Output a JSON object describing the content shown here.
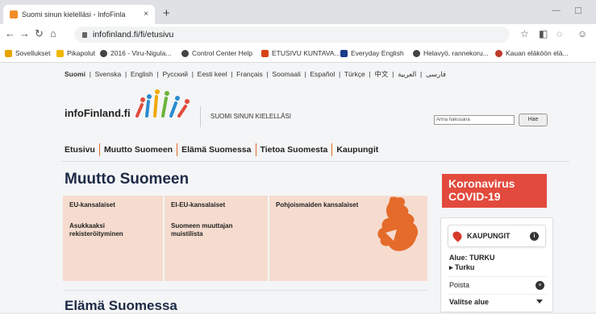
{
  "browser": {
    "tab_title": "Suomi sinun kielelläsi - InfoFinla",
    "tab_close": "×",
    "new_tab": "+",
    "url": "infofinland.fi/fi/etusivu"
  },
  "bookmarks": [
    {
      "label": "Sovellukset",
      "color": "#e6a400"
    },
    {
      "label": "Pikapolut",
      "color": "#f2b600"
    },
    {
      "label": "2016 - Viru-Nigula...",
      "color": "#444444"
    },
    {
      "label": "Control Center Help",
      "color": "#444444"
    },
    {
      "label": "ETUSIVU KUNTAVA...",
      "color": "#d84315"
    },
    {
      "label": "Everyday English",
      "color": "#1a3c8c"
    },
    {
      "label": "Helavyö, rannekoru...",
      "color": "#444444"
    },
    {
      "label": "Kauan eläköön elä...",
      "color": "#c0392b"
    }
  ],
  "languages": [
    "Suomi",
    "Svenska",
    "English",
    "Русский",
    "Eesti keel",
    "Français",
    "Soomaali",
    "Español",
    "Türkçe",
    "中文",
    "فارسی",
    "العربية"
  ],
  "header": {
    "logo": "infoFinland.fi",
    "tagline": "SUOMI SINUN KIELELLÄSI",
    "search_placeholder": "Anna hakusana",
    "search_button": "Hae"
  },
  "nav": [
    "Etusivu",
    "Muutto Suomeen",
    "Elämä Suomessa",
    "Tietoa Suomesta",
    "Kaupungit"
  ],
  "main": {
    "title": "Muutto Suomeen",
    "cells": [
      "EU-kansalaiset",
      "EI-EU-kansalaiset",
      "Pohjoismaiden kansalaiset",
      "Asukkaaksi rekisteröityminen",
      "Suomeen muuttajan muistilista"
    ],
    "next_title": "Elämä Suomessa"
  },
  "sidebar": {
    "corona": "Koronavirus COVID-19",
    "kaupungit": "KAUPUNGIT",
    "info": "i",
    "alue_label": "Alue: TURKU",
    "alue_item": "▸ Turku",
    "poista": "Poista",
    "poista_icon": "×",
    "valitse": "Valitse alue"
  },
  "colors": {
    "accent": "#e46b2a",
    "corona": "#e24a3d",
    "cell_bg": "#f6dccf",
    "title": "#1d2a47"
  }
}
